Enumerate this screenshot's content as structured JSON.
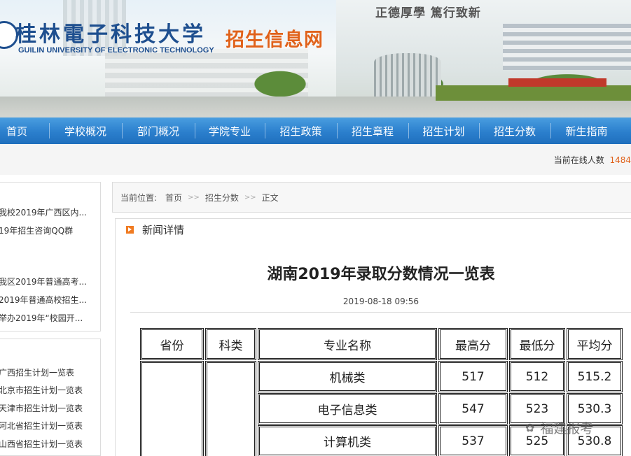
{
  "banner": {
    "school_name_cn": "桂林電子科技大学",
    "school_name_en": "GUILIN UNIVERSITY OF ELECTRONIC TECHNOLOGY",
    "site_name": "招生信息网",
    "motto": "正德厚學 篤行致新"
  },
  "nav": {
    "items": [
      {
        "label": "首页"
      },
      {
        "label": "学校概况"
      },
      {
        "label": "部门概况"
      },
      {
        "label": "学院专业"
      },
      {
        "label": "招生政策"
      },
      {
        "label": "招生章程"
      },
      {
        "label": "招生计划"
      },
      {
        "label": "招生分数"
      },
      {
        "label": "新生指南"
      }
    ]
  },
  "online": {
    "label": "当前在线人数",
    "count": "1484"
  },
  "sidebar": {
    "news": [
      {
        "label": "我校2019年广西区内..."
      },
      {
        "label": "19年招生咨询QQ群"
      },
      {
        "label": "我区2019年普通高考..."
      },
      {
        "label": "2019年普通高校招生..."
      },
      {
        "label": "举办2019年“校园开..."
      }
    ],
    "plans": [
      {
        "label": "广西招生计划一览表"
      },
      {
        "label": "北京市招生计划一览表"
      },
      {
        "label": "天津市招生计划一览表"
      },
      {
        "label": "河北省招生计划一览表"
      },
      {
        "label": "山西省招生计划一览表"
      }
    ]
  },
  "breadcrumb": {
    "prefix": "当前位置:",
    "items": [
      "首页",
      "招生分数",
      "正文"
    ],
    "separator": ">>"
  },
  "article": {
    "section_label": "新闻详情",
    "title": "湖南2019年录取分数情况一览表",
    "date": "2019-08-18 09:56"
  },
  "table": {
    "headers": [
      "省份",
      "科类",
      "专业名称",
      "最高分",
      "最低分",
      "平均分"
    ],
    "rows": [
      {
        "major": "机械类",
        "max": "517",
        "min": "512",
        "avg": "515.2"
      },
      {
        "major": "电子信息类",
        "max": "547",
        "min": "523",
        "avg": "530.3"
      },
      {
        "major": "计算机类",
        "max": "537",
        "min": "525",
        "avg": "530.8"
      }
    ]
  },
  "watermark": {
    "text": "福建报考"
  },
  "colors": {
    "nav_blue": "#2b7fcd",
    "accent_orange": "#e0621b",
    "school_blue": "#1e4f8f"
  }
}
